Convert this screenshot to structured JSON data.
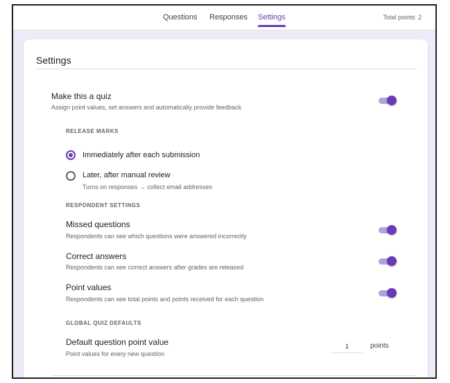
{
  "tabs": [
    {
      "label": "Questions"
    },
    {
      "label": "Responses"
    },
    {
      "label": "Settings"
    }
  ],
  "total_points": "Total points: 2",
  "settings": {
    "title": "Settings",
    "quiz": {
      "title": "Make this a quiz",
      "subtitle": "Assign point values, set answers and automatically provide feedback",
      "enabled": true
    },
    "release_marks": {
      "label": "RELEASE MARKS",
      "options": [
        {
          "label": "Immediately after each submission",
          "checked": true
        },
        {
          "label": "Later, after manual review",
          "sublabel": "Turns on responses → collect email addresses",
          "checked": false
        }
      ]
    },
    "respondent_settings": {
      "label": "RESPONDENT SETTINGS",
      "items": [
        {
          "title": "Missed questions",
          "subtitle": "Respondents can see which questions were answered incorrectly",
          "enabled": true
        },
        {
          "title": "Correct answers",
          "subtitle": "Respondents can see correct answers after grades are released",
          "enabled": true
        },
        {
          "title": "Point values",
          "subtitle": "Respondents can see total points and points received for each question",
          "enabled": true
        }
      ]
    },
    "global_defaults": {
      "label": "GLOBAL QUIZ DEFAULTS",
      "title": "Default question point value",
      "subtitle": "Point values for every new question",
      "value": "1",
      "unit": "points"
    }
  },
  "colors": {
    "accent": "#673ab7",
    "toggle_track": "#b4a1dc",
    "background": "#efeaf7"
  }
}
